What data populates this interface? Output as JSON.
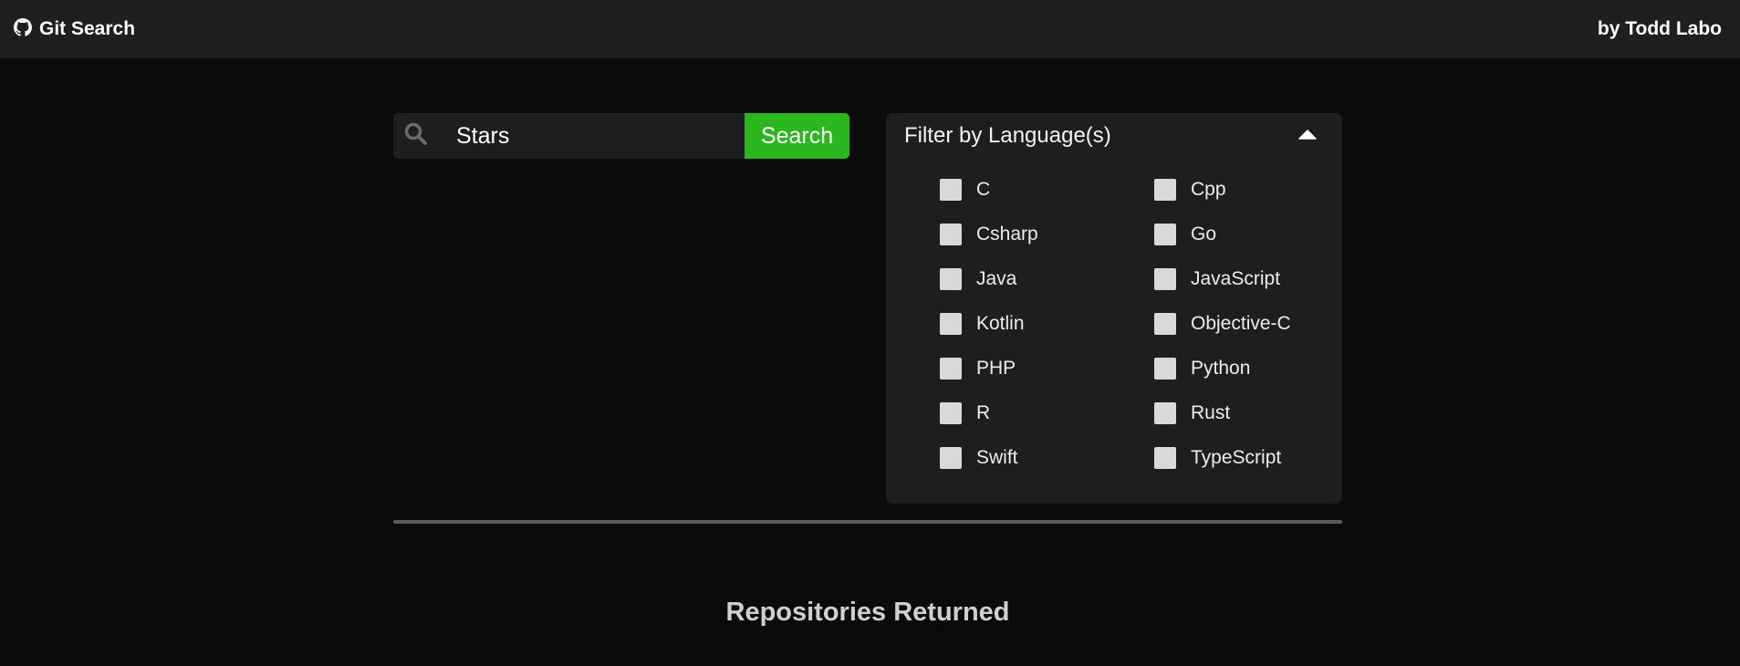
{
  "header": {
    "brand_title": "Git Search",
    "author": "by Todd Labo",
    "brand_icon": "github-icon"
  },
  "search": {
    "value": "Stars",
    "placeholder": "Stars",
    "button_label": "Search",
    "icon": "search-icon",
    "button_color": "#2ab81e"
  },
  "filter": {
    "title": "Filter by Language(s)",
    "toggle_icon": "caret-up-icon",
    "languages": [
      "C",
      "Cpp",
      "Csharp",
      "Go",
      "Java",
      "JavaScript",
      "Kotlin",
      "Objective-C",
      "PHP",
      "Python",
      "R",
      "Rust",
      "Swift",
      "TypeScript"
    ]
  },
  "results": {
    "heading": "Repositories Returned"
  }
}
